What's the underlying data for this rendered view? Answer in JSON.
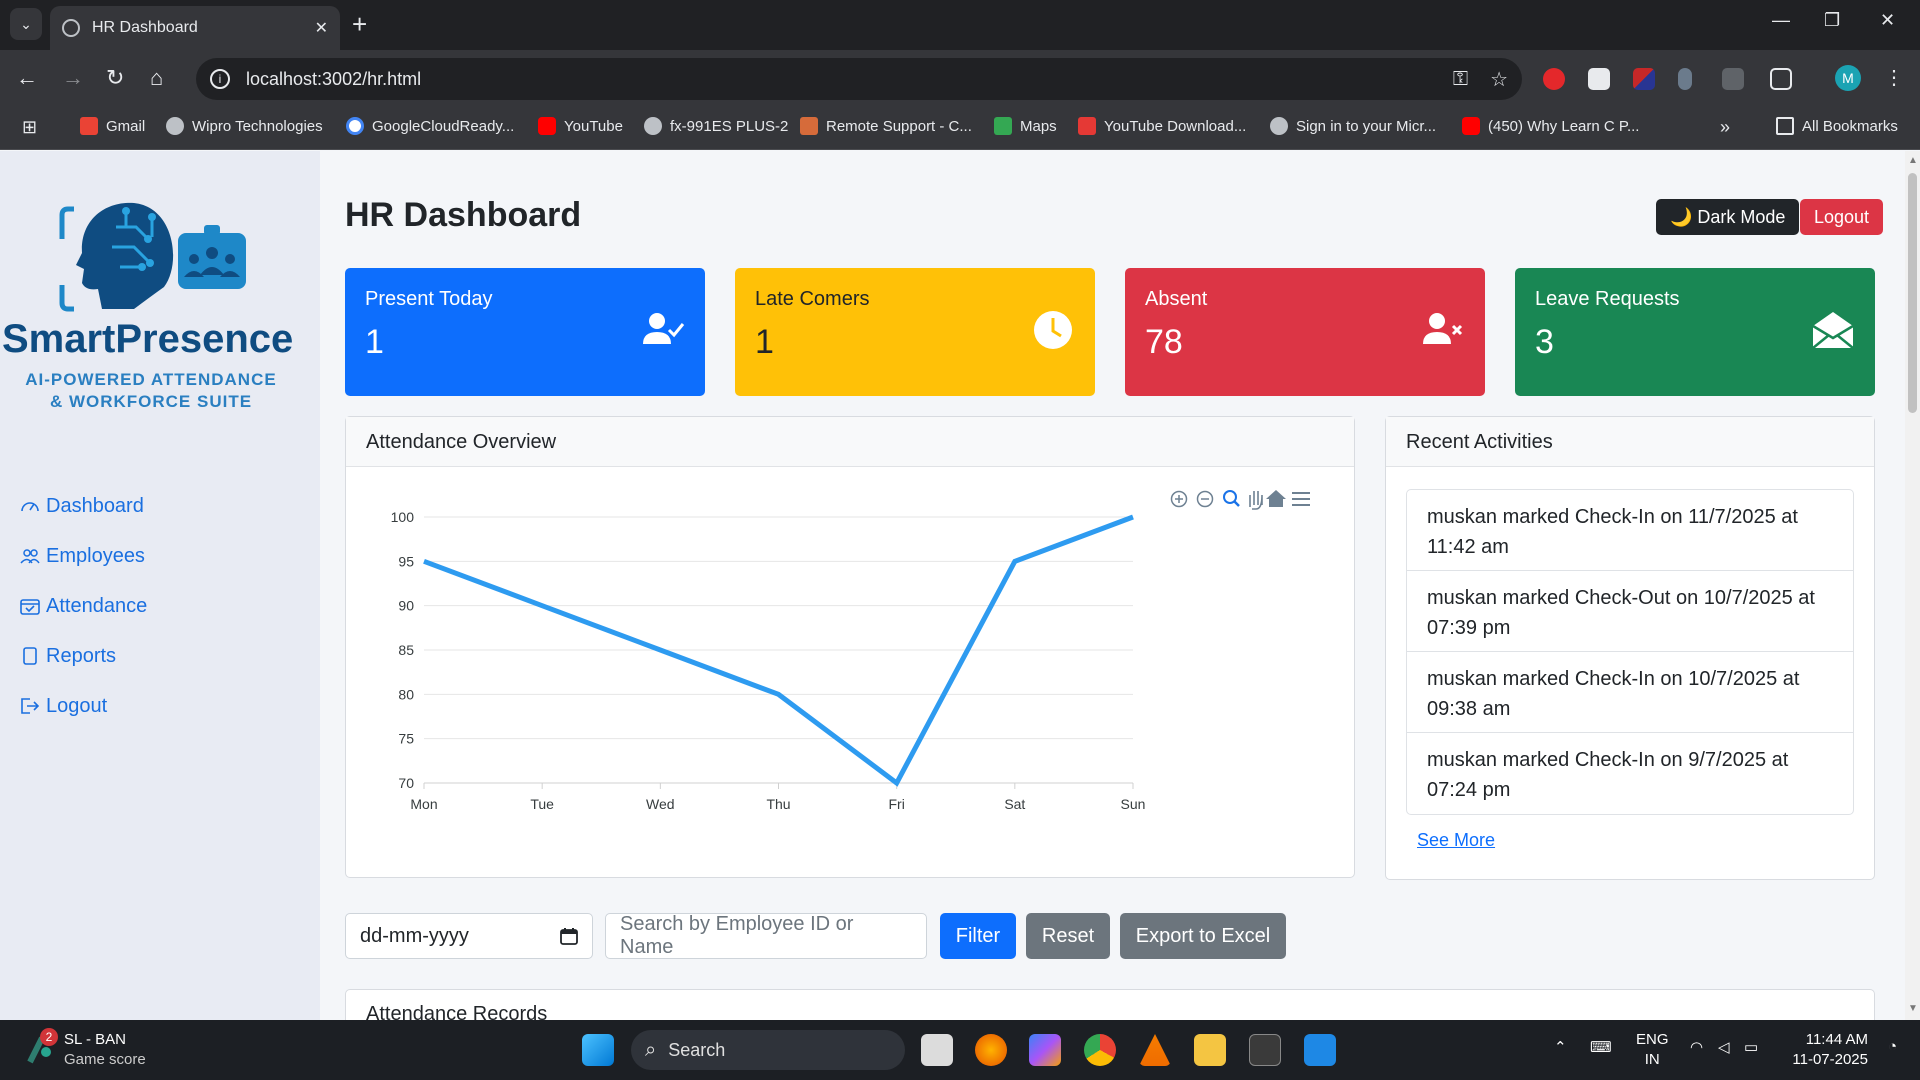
{
  "browser": {
    "tab_title": "HR Dashboard",
    "url": "localhost:3002/hr.html",
    "profile_initial": "M",
    "bookmarks": [
      "Gmail",
      "Wipro Technologies",
      "GoogleCloudReady...",
      "YouTube",
      "fx-991ES PLUS-2",
      "Remote Support - C...",
      "Maps",
      "YouTube Download...",
      "Sign in to your Micr...",
      "(450) Why Learn C P..."
    ],
    "all_bookmarks": "All Bookmarks"
  },
  "sidebar": {
    "brand": "SmartPresence",
    "tagline": "AI-POWERED ATTENDANCE & WORKFORCE SUITE",
    "items": [
      {
        "label": "Dashboard",
        "icon": "gauge-icon"
      },
      {
        "label": "Employees",
        "icon": "people-icon"
      },
      {
        "label": "Attendance",
        "icon": "calendar-check-icon"
      },
      {
        "label": "Reports",
        "icon": "document-icon"
      },
      {
        "label": "Logout",
        "icon": "logout-icon"
      }
    ]
  },
  "header": {
    "title": "HR Dashboard",
    "dark_mode": "🌙 Dark Mode",
    "logout": "Logout"
  },
  "cards": [
    {
      "label": "Present Today",
      "value": "1",
      "color": "#0d6efd",
      "text_color": "#ffffff",
      "icon": "user-check-icon"
    },
    {
      "label": "Late Comers",
      "value": "1",
      "color": "#ffc107",
      "text_color": "#212529",
      "icon": "clock-icon"
    },
    {
      "label": "Absent",
      "value": "78",
      "color": "#dc3545",
      "text_color": "#ffffff",
      "icon": "user-x-icon"
    },
    {
      "label": "Leave Requests",
      "value": "3",
      "color": "#198754",
      "text_color": "#ffffff",
      "icon": "envelope-open-icon"
    }
  ],
  "attendance_panel": {
    "title": "Attendance Overview"
  },
  "chart_data": {
    "type": "line",
    "categories": [
      "Mon",
      "Tue",
      "Wed",
      "Thu",
      "Fri",
      "Sat",
      "Sun"
    ],
    "values": [
      95,
      90,
      85,
      80,
      70,
      95,
      100
    ],
    "yticks": [
      "70",
      "75",
      "80",
      "85",
      "90",
      "95",
      "100"
    ],
    "ylim": [
      70,
      100
    ],
    "grid": true,
    "line_color": "#2e9bf0"
  },
  "activities_panel": {
    "title": "Recent Activities",
    "items": [
      "muskan marked Check-In on 11/7/2025 at 11:42 am",
      "muskan marked Check-Out on 10/7/2025 at 07:39 pm",
      "muskan marked Check-In on 10/7/2025 at 09:38 am",
      "muskan marked Check-In on 9/7/2025 at 07:24 pm"
    ],
    "see_more": "See More"
  },
  "filters": {
    "date_placeholder": "dd-mm-yyyy",
    "search_placeholder": "Search by Employee ID or Name",
    "filter": "Filter",
    "reset": "Reset",
    "export": "Export to Excel"
  },
  "records": {
    "title": "Attendance Records"
  },
  "taskbar": {
    "badge": "2",
    "weather_title": "SL - BAN",
    "weather_sub": "Game score",
    "search": "Search",
    "lang": "ENG",
    "region": "IN",
    "time": "11:44 AM",
    "date": "11-07-2025"
  }
}
